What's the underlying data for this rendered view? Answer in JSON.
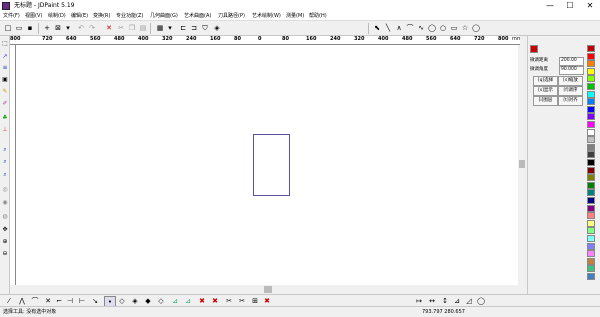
{
  "window": {
    "title": "无标题 - JDPaint 5.19",
    "controls": [
      "—",
      "☐",
      "✕"
    ]
  },
  "menu": [
    "文件(F)",
    "视图(V)",
    "绘制(D)",
    "编辑(E)",
    "变换(R)",
    "专业功能(Z)",
    "几何曲面(G)",
    "艺术曲面(A)",
    "刀具路径(P)",
    "艺术绘制(W)",
    "测量(M)",
    "帮助(H)"
  ],
  "ruler": {
    "h_labels": [
      "800",
      "720",
      "640",
      "560",
      "480",
      "400",
      "320",
      "240",
      "160",
      "80",
      "0",
      "80",
      "160",
      "240",
      "320",
      "400",
      "480",
      "560",
      "640",
      "720",
      "800"
    ],
    "unit": "mm"
  },
  "right_panel": {
    "labels": {
      "slight_distance": "微调距离",
      "slight_angle": "微调角度"
    },
    "values": {
      "slight_distance": "200.00",
      "slight_angle": "90.000"
    },
    "buttons": [
      "[q]选择",
      "[s]缩放",
      "[s]显示",
      "[f]调序",
      "[i]图层",
      "[t]对齐"
    ]
  },
  "palette": {
    "colors": [
      "#c00000",
      "#ff0000",
      "#ff8000",
      "#ffff00",
      "#80ff00",
      "#00c000",
      "#00ffff",
      "#0080ff",
      "#0000ff",
      "#8000ff",
      "#ff00ff",
      "#ffffff",
      "#c0c0c0",
      "#808080",
      "#404040",
      "#000000",
      "#800000",
      "#808000",
      "#008000",
      "#008080",
      "#000080",
      "#800080",
      "#ff8080",
      "#ffff80",
      "#80ff80",
      "#80ffff",
      "#8080ff",
      "#ff80ff",
      "#c08040",
      "#40c080",
      "#4080c0"
    ]
  },
  "status": {
    "tool": "选择工具: 没有选中对象",
    "coords": "793.797  280.657"
  }
}
